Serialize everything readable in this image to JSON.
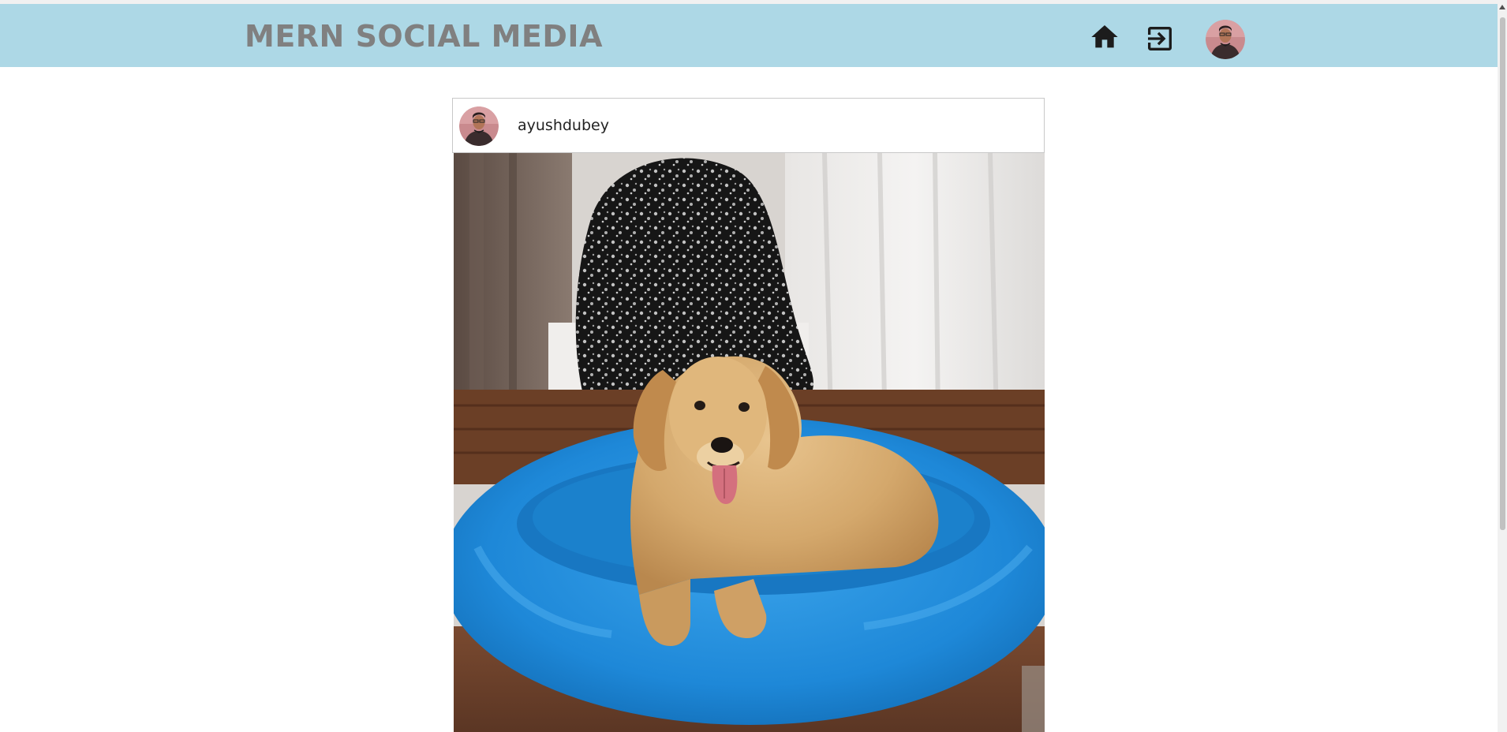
{
  "navbar": {
    "brand": "MERN SOCIAL MEDIA",
    "background": "#add8e6",
    "brand_color": "#808080",
    "icons": [
      "home-icon",
      "logout-icon"
    ],
    "avatar_alt": "user avatar"
  },
  "post": {
    "username": "ayushdubey",
    "image_alt": "golden retriever lying in a blue fluffy dog bed"
  }
}
